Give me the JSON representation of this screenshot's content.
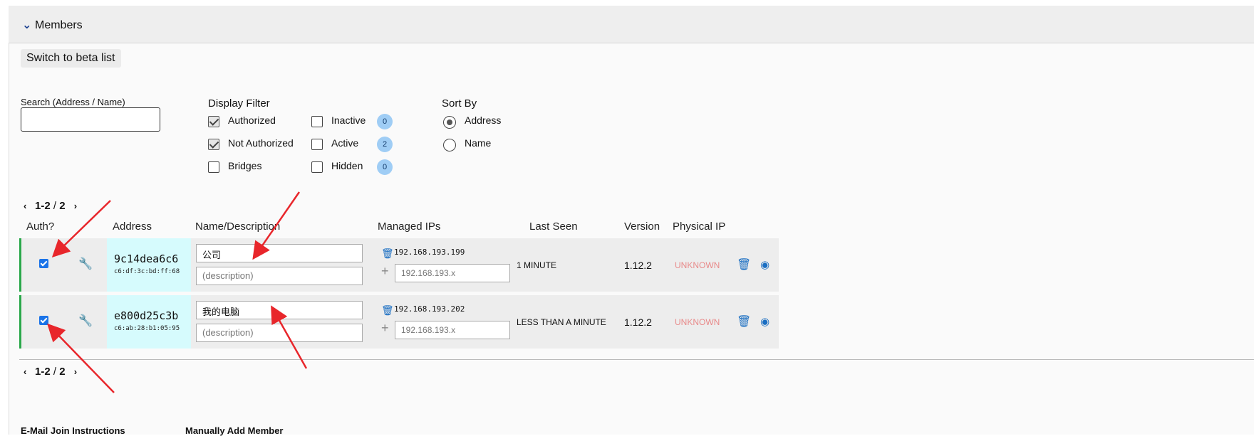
{
  "section": {
    "title": "Members"
  },
  "switch_button": "Switch to beta list",
  "search": {
    "label": "Search (Address / Name)",
    "value": ""
  },
  "display_filter": {
    "title": "Display Filter",
    "left": [
      {
        "label": "Authorized",
        "checked": true
      },
      {
        "label": "Not Authorized",
        "checked": true
      },
      {
        "label": "Bridges",
        "checked": false
      }
    ],
    "right": [
      {
        "label": "Inactive",
        "checked": false,
        "count": "0"
      },
      {
        "label": "Active",
        "checked": false,
        "count": "2"
      },
      {
        "label": "Hidden",
        "checked": false,
        "count": "0"
      }
    ]
  },
  "sort_by": {
    "title": "Sort By",
    "options": [
      {
        "label": "Address",
        "selected": true
      },
      {
        "label": "Name",
        "selected": false
      }
    ]
  },
  "pagination": {
    "range": "1-2",
    "separator": " / ",
    "total": "2"
  },
  "columns": [
    "Auth?",
    "Address",
    "Name/Description",
    "Managed IPs",
    "Last Seen",
    "Version",
    "Physical IP"
  ],
  "members": [
    {
      "authorized": true,
      "address": "9c14dea6c6",
      "mac": "c6:df:3c:bd:ff:68",
      "name": "公司",
      "description_placeholder": "(description)",
      "ip": "192.168.193.199",
      "ip_placeholder": "192.168.193.x",
      "last_seen": "1 MINUTE",
      "version": "1.12.2",
      "physical_ip": "UNKNOWN"
    },
    {
      "authorized": true,
      "address": "e800d25c3b",
      "mac": "c6:ab:28:b1:05:95",
      "name": "我的电脑",
      "description_placeholder": "(description)",
      "ip": "192.168.193.202",
      "ip_placeholder": "192.168.193.x",
      "last_seen": "LESS THAN A MINUTE",
      "version": "1.12.2",
      "physical_ip": "UNKNOWN"
    }
  ],
  "footer_sections": [
    "E-Mail Join Instructions",
    "Manually Add Member"
  ],
  "colors": {
    "accent": "#1a6ec2",
    "active_border": "#2aa84a",
    "address_bg": "#d6fbfd",
    "unknown": "#e88a8a",
    "annotation": "#e8262b"
  }
}
